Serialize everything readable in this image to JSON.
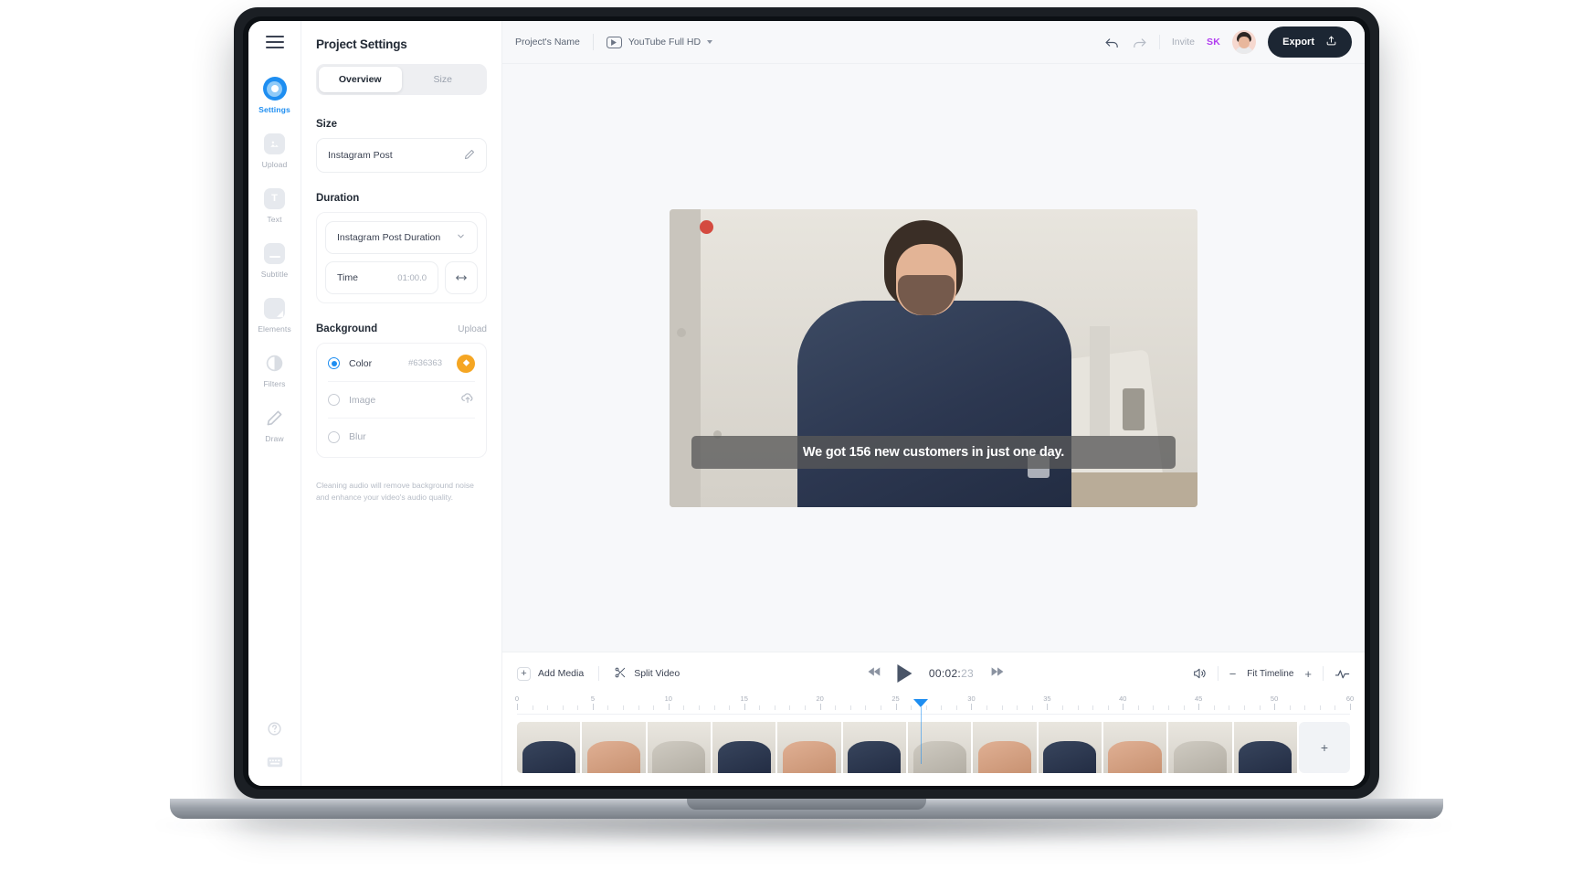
{
  "rail": {
    "menu_icon": "hamburger-icon",
    "items": [
      {
        "label": "Settings",
        "icon": "settings-ring-icon",
        "active": true
      },
      {
        "label": "Upload",
        "icon": "image-upload-icon",
        "active": false
      },
      {
        "label": "Text",
        "icon": "text-t-icon",
        "active": false
      },
      {
        "label": "Subtitle",
        "icon": "subtitle-icon",
        "active": false
      },
      {
        "label": "Elements",
        "icon": "elements-icon",
        "active": false
      },
      {
        "label": "Filters",
        "icon": "filters-contrast-icon",
        "active": false
      },
      {
        "label": "Draw",
        "icon": "pencil-draw-icon",
        "active": false
      }
    ],
    "bottom": [
      {
        "icon": "help-question-icon"
      },
      {
        "icon": "keyboard-shortcuts-icon"
      }
    ]
  },
  "panel": {
    "title": "Project Settings",
    "tabs": [
      {
        "label": "Overview",
        "active": true
      },
      {
        "label": "Size",
        "active": false
      }
    ],
    "size": {
      "heading": "Size",
      "value": "Instagram Post",
      "edit_icon": "pencil-edit-icon"
    },
    "duration": {
      "heading": "Duration",
      "preset": "Instagram Post Duration",
      "dropdown_icon": "chevron-down-icon",
      "time_label": "Time",
      "time_value": "01:00.0",
      "swap_icon": "left-right-arrow-icon"
    },
    "background": {
      "heading": "Background",
      "upload_label": "Upload",
      "options": [
        {
          "label": "Color",
          "selected": true,
          "value": "#636363",
          "action_icon": "paint-bucket-icon"
        },
        {
          "label": "Image",
          "selected": false,
          "value": "",
          "action_icon": "cloud-upload-icon"
        },
        {
          "label": "Blur",
          "selected": false,
          "value": "",
          "action_icon": ""
        }
      ]
    },
    "note": "Cleaning audio will remove background noise and enhance your video's audio quality."
  },
  "topbar": {
    "project_name": "Project's Name",
    "preset_icon": "youtube-play-icon",
    "preset_label": "YouTube Full HD",
    "preset_caret": "chevron-down-icon",
    "undo_icon": "undo-arrow-icon",
    "redo_icon": "redo-arrow-icon",
    "invite_label": "Invite",
    "collaborator_initials": "SK",
    "avatar": "user-avatar",
    "export_label": "Export",
    "export_icon": "share-upload-icon"
  },
  "preview": {
    "subtitle": "We got 156 new customers in just one day."
  },
  "timeline": {
    "add_media_label": "Add Media",
    "add_media_icon": "plus-icon",
    "split_video_label": "Split Video",
    "split_video_icon": "scissors-icon",
    "rewind_icon": "rewind-icon",
    "play_icon": "play-icon",
    "forward_icon": "fast-forward-icon",
    "timecode_main": "00:02:",
    "timecode_frames": "23",
    "volume_icon": "volume-icon",
    "zoom_out_icon": "minus-icon",
    "zoom_label": "Fit Timeline",
    "zoom_in_icon": "plus-icon",
    "waveform_icon": "waveform-icon",
    "ruler_labels": [
      "0",
      "5",
      "10",
      "15",
      "20",
      "25",
      "30",
      "35",
      "40",
      "45",
      "50",
      "60"
    ],
    "playhead_position_label": "29",
    "add_clip_icon": "plus-icon",
    "clip_count": 12
  }
}
